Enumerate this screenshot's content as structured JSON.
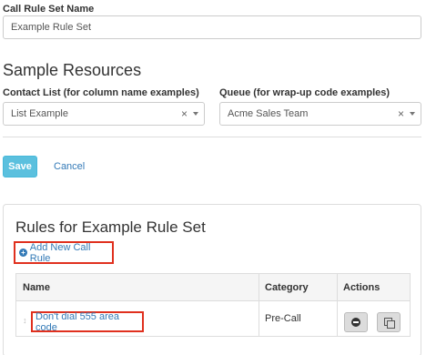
{
  "ruleset": {
    "name_label": "Call Rule Set Name",
    "name_value": "Example Rule Set"
  },
  "sample_resources": {
    "title": "Sample Resources",
    "contact_list_label": "Contact List (for column name examples)",
    "contact_list_value": "List Example",
    "queue_label": "Queue (for wrap-up code examples)",
    "queue_value": "Acme Sales Team",
    "clear_glyph": "×"
  },
  "actions": {
    "save_label": "Save",
    "cancel_label": "Cancel"
  },
  "rules_panel": {
    "title": "Rules for Example Rule Set",
    "add_rule_label": "Add New Call Rule",
    "columns": [
      "Name",
      "Category",
      "Actions"
    ],
    "rows": [
      {
        "name": "Don't dial 555 area code",
        "category": "Pre-Call"
      }
    ]
  },
  "colors": {
    "accent": "#5bc0de",
    "link": "#337ab7",
    "highlight_border": "#e0301e"
  }
}
